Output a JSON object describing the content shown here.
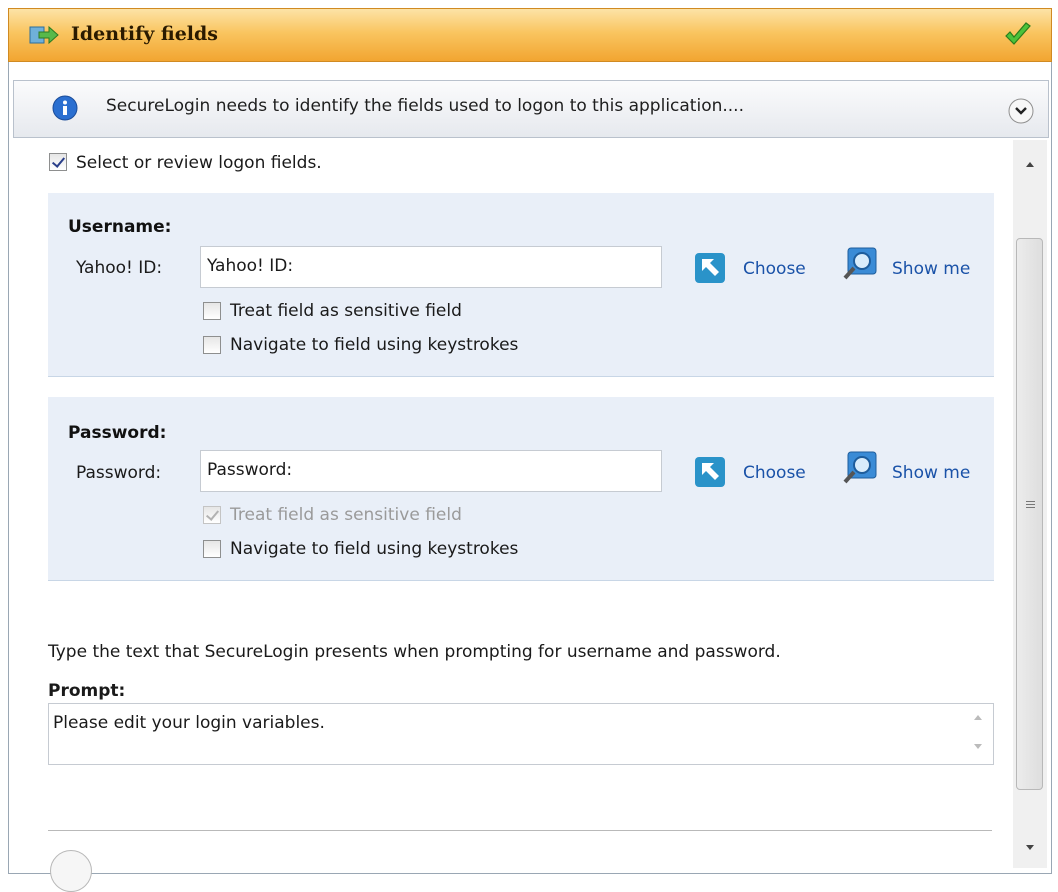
{
  "title_bar": {
    "title": "Identify fields",
    "icon": "arrow-right-icon",
    "status_icon": "check-icon"
  },
  "info_bar": {
    "message": "SecureLogin needs to identify the fields used to logon to this application....",
    "icon": "info-icon",
    "collapse_icon": "chevron-down-icon"
  },
  "select_checkbox": {
    "label": "Select or review logon fields.",
    "checked": true
  },
  "username": {
    "heading": "Username:",
    "field_label": "Yahoo! ID:",
    "field_value": "Yahoo! ID:",
    "choose_label": "Choose",
    "show_label": "Show me",
    "sensitive": {
      "label": "Treat field as sensitive field",
      "checked": false,
      "disabled": false
    },
    "navigate": {
      "label": "Navigate to field using keystrokes",
      "checked": false
    }
  },
  "password": {
    "heading": "Password:",
    "field_label": "Password:",
    "field_value": "Password:",
    "choose_label": "Choose",
    "show_label": "Show me",
    "sensitive": {
      "label": "Treat field as sensitive field",
      "checked": true,
      "disabled": true
    },
    "navigate": {
      "label": "Navigate to field using keystrokes",
      "checked": false
    }
  },
  "prompt": {
    "instruction": "Type the text that SecureLogin presents when prompting for username and password.",
    "label": "Prompt:",
    "value": "Please edit your login variables."
  },
  "colors": {
    "title_bar": "#f9c560",
    "section_bg": "#e9eff8",
    "link": "#1a52a8",
    "check": "#3fae2a"
  }
}
